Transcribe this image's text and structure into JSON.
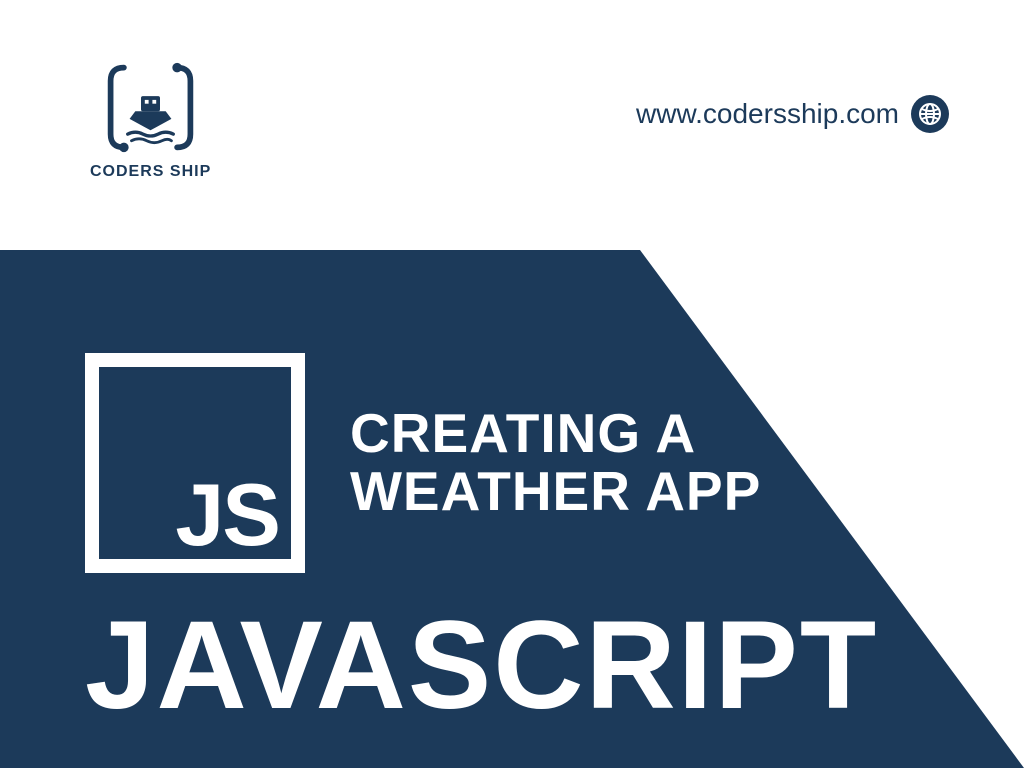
{
  "logo": {
    "brand_text": "CODERS SHIP"
  },
  "header": {
    "url": "www.codersship.com"
  },
  "hero": {
    "badge_text": "JS",
    "title_line1": "CREATING A",
    "title_line2": "WEATHER APP",
    "big_text": "JAVASCRIPT"
  },
  "colors": {
    "primary": "#1c3a5a",
    "white": "#ffffff"
  }
}
